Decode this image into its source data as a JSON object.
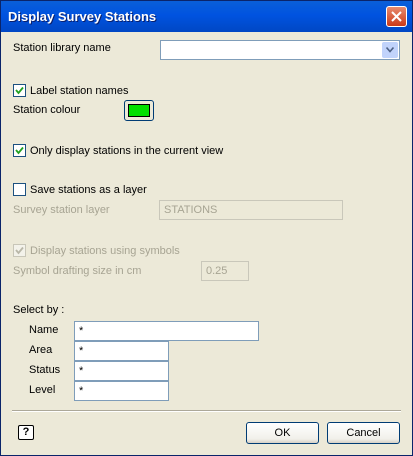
{
  "window": {
    "title": "Display Survey Stations"
  },
  "library": {
    "label": "Station library name",
    "value": ""
  },
  "label_names": {
    "label": "Label station names",
    "checked": true
  },
  "station_colour": {
    "label": "Station colour",
    "color": "#00e000"
  },
  "only_current_view": {
    "label": "Only display stations in the current view",
    "checked": true
  },
  "save_layer": {
    "label": "Save stations as a layer",
    "checked": false
  },
  "survey_layer": {
    "label": "Survey station layer",
    "value": "STATIONS"
  },
  "display_symbols": {
    "label": "Display stations using symbols",
    "checked": true
  },
  "symbol_size": {
    "label": "Symbol drafting size in cm",
    "value": "0.25"
  },
  "select_by": {
    "heading": "Select by :",
    "name": {
      "label": "Name",
      "value": "*"
    },
    "area": {
      "label": "Area",
      "value": "*"
    },
    "status": {
      "label": "Status",
      "value": "*"
    },
    "level": {
      "label": "Level",
      "value": "*"
    }
  },
  "footer": {
    "help_label": "?",
    "ok_label": "OK",
    "cancel_label": "Cancel"
  },
  "icons": {
    "close": "close-icon",
    "dropdown": "chevron-down-icon",
    "check": "checkmark-icon",
    "help": "help-icon"
  }
}
